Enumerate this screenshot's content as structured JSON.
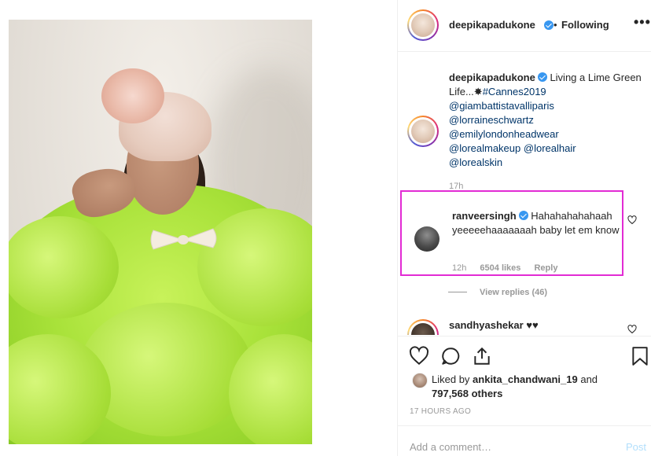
{
  "post": {
    "image_alt": "Woman in lime green tulle gown and pink turban",
    "author": "deepikapadukone",
    "follow_status": "Following",
    "dot": "•",
    "more": "•••"
  },
  "caption": {
    "username": "deepikapadukone",
    "text_prefix": "Living a Lime Green Life...",
    "emoji": "✸",
    "hashtag": "#Cannes2019",
    "mentions": [
      "@giambattistavalliparis",
      "@lorraineschwartz",
      "@emilylondonheadwear",
      "@lorealmakeup",
      "@lorealhair",
      "@lorealskin"
    ],
    "time": "17h"
  },
  "comment": {
    "username": "ranveersingh",
    "text": "Hahahahahahaah yeeeeehaaaaaaah baby let em know",
    "time": "12h",
    "likes": "6504 likes",
    "reply": "Reply",
    "view_replies": "View replies (46)"
  },
  "comment2": {
    "username": "sandhyashekar",
    "text": "♥♥"
  },
  "actions": {
    "liked_by_prefix": "Liked by",
    "liked_by_user": "ankita_chandwani_19",
    "liked_and": "and",
    "liked_others": "797,568 others",
    "time_ago": "17 HOURS AGO",
    "comment_placeholder": "Add a comment…",
    "post_label": "Post"
  },
  "colors": {
    "highlight_box": "#e22bd4",
    "verified": "#3897f0",
    "link": "#003569"
  }
}
